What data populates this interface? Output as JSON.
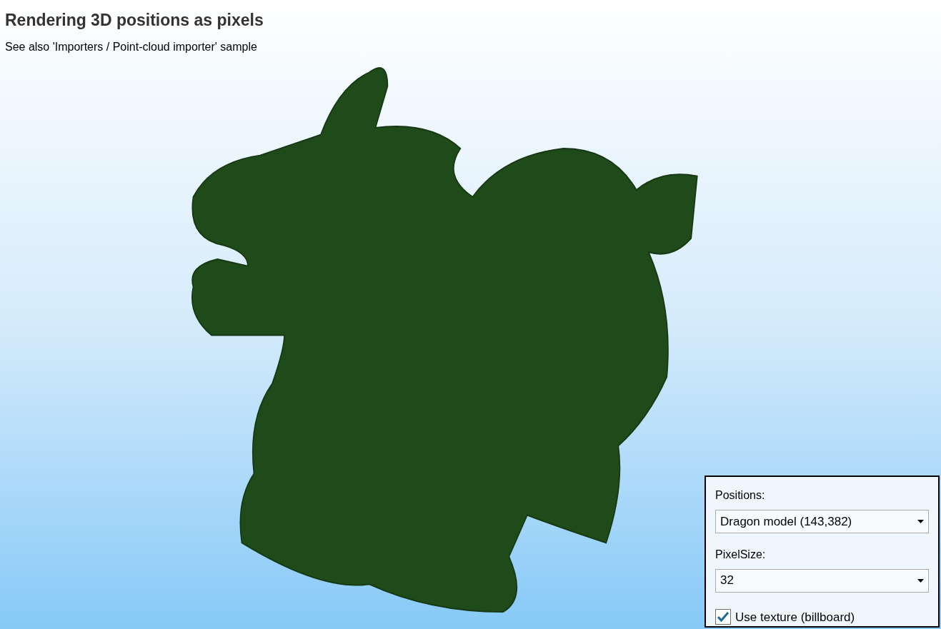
{
  "title": "Rendering 3D positions as pixels",
  "subtitle": "See also 'Importers / Point-cloud importer' sample",
  "settings_panel": {
    "positions": {
      "label": "Positions:",
      "value": "Dragon model (143,382)"
    },
    "pixel_size": {
      "label": "PixelSize:",
      "value": "32"
    },
    "use_texture": {
      "label": "Use texture (billboard)",
      "checked": true
    }
  }
}
